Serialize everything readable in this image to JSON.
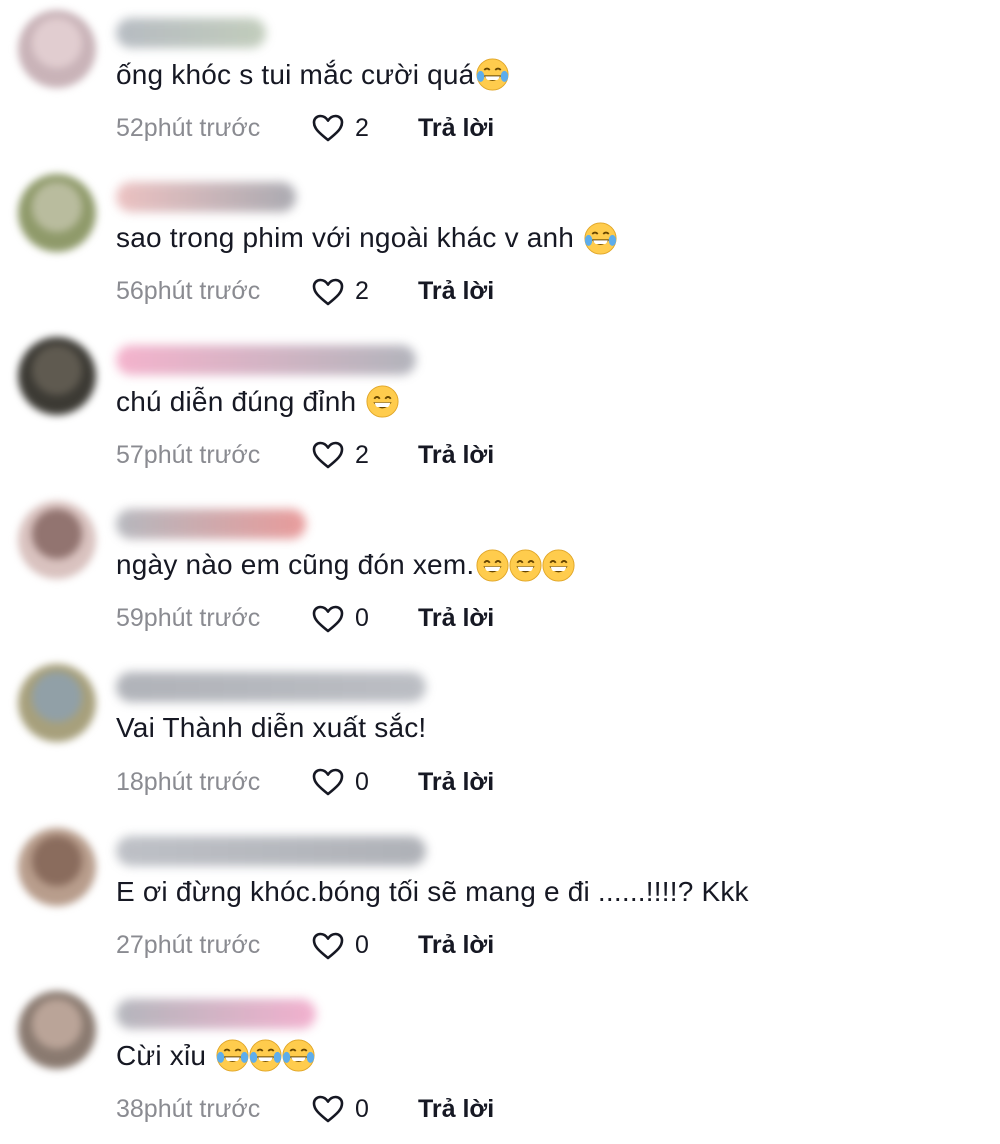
{
  "comments": [
    {
      "text": "ống khóc s tui mắc cười quá",
      "emojis": [
        "face-with-tears-of-joy-icon"
      ],
      "time": "52phút trước",
      "likes": "2",
      "reply": "Trả lời",
      "avatar_colors": [
        "#c9b3b8",
        "#e8d6d8"
      ],
      "name_colors": [
        "#aab0b8",
        "#b7c4b0"
      ],
      "name_width": 0.3
    },
    {
      "text": "sao trong phim với ngoài khác v anh ",
      "emojis": [
        "face-with-tears-of-joy-icon"
      ],
      "time": "56phút trước",
      "likes": "2",
      "reply": "Trả lời",
      "avatar_colors": [
        "#8f9a6a",
        "#c7c7b0"
      ],
      "name_colors": [
        "#e9b7b7",
        "#9c9ca4"
      ],
      "name_width": 0.36
    },
    {
      "text": "chú diễn đúng đỉnh ",
      "emojis": [
        "grinning-face-with-smiling-eyes-icon"
      ],
      "time": "57phút trước",
      "likes": "2",
      "reply": "Trả lời",
      "avatar_colors": [
        "#3c3a34",
        "#6b6659"
      ],
      "name_colors": [
        "#f3a6c4",
        "#a5a7b0"
      ],
      "name_width": 0.6
    },
    {
      "text": "ngày nào em cũng đón xem.",
      "emojis": [
        "grinning-face-with-smiling-eyes-icon",
        "grinning-face-with-smiling-eyes-icon",
        "grinning-face-with-smiling-eyes-icon"
      ],
      "time": "59phút trước",
      "likes": "0",
      "reply": "Trả lời",
      "avatar_colors": [
        "#d9c2bf",
        "#7a5a55"
      ],
      "name_colors": [
        "#a9acb3",
        "#e58a8a"
      ],
      "name_width": 0.38
    },
    {
      "text": "Vai Thành diễn xuất sắc!",
      "emojis": [],
      "time": "18phút trước",
      "likes": "0",
      "reply": "Trả lời",
      "avatar_colors": [
        "#a7a07c",
        "#8aa0b5"
      ],
      "name_colors": [
        "#a3a6ad",
        "#b0b3ba"
      ],
      "name_width": 0.62
    },
    {
      "text": "E ơi đừng khóc.bóng tối sẽ mang e đi ......!!!!? Kkk",
      "emojis": [],
      "time": "27phút trước",
      "likes": "0",
      "reply": "Trả lời",
      "avatar_colors": [
        "#b89d8c",
        "#7b5c4e"
      ],
      "name_colors": [
        "#b3b6bd",
        "#a1a4ab"
      ],
      "name_width": 0.62
    },
    {
      "text": "Cừi xỉu ",
      "emojis": [
        "face-with-tears-of-joy-icon",
        "face-with-tears-of-joy-icon",
        "face-with-tears-of-joy-icon"
      ],
      "time": "38phút trước",
      "likes": "0",
      "reply": "Trả lời",
      "avatar_colors": [
        "#8a7a70",
        "#c9b3a5"
      ],
      "name_colors": [
        "#a7aab1",
        "#f0a3c6"
      ],
      "name_width": 0.4
    }
  ]
}
